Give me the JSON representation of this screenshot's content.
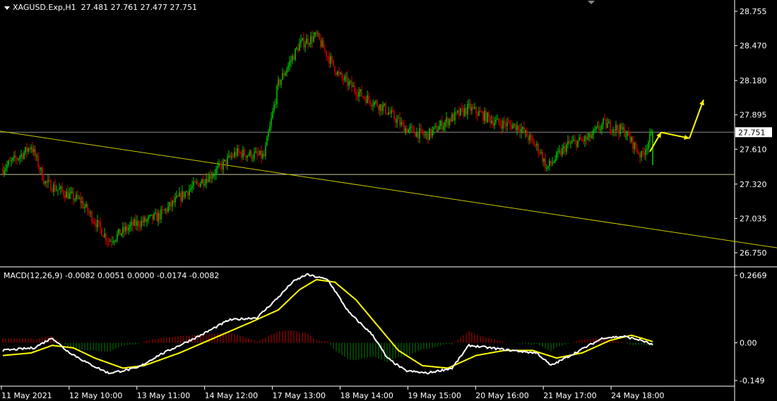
{
  "header": {
    "price_text": "XAGUSD.Exp,H1  27.481 27.761 27.477 27.751",
    "macd_text": "MACD(12,26,9) -0.0082 0.0051 0.0000 -0.0174 -0.0082"
  },
  "colors": {
    "background": "#000000",
    "bull": "#00c000",
    "bear": "#d00000",
    "trendline": "#c8c800",
    "arrow": "#ffff00",
    "macd_line": "#ffffff",
    "signal_line": "#ffff00",
    "grid": "#ffffff"
  },
  "chart_data": [
    {
      "type": "candlestick",
      "symbol": "XAGUSD.Exp",
      "timeframe": "H1",
      "ylim": [
        26.68,
        28.85
      ],
      "y_ticks": [
        "28.755",
        "28.470",
        "28.180",
        "27.895",
        "27.610",
        "27.320",
        "27.035",
        "26.750"
      ],
      "x_ticks": [
        "11 May 2021",
        "12 May 10:00",
        "13 May 11:00",
        "14 May 12:00",
        "17 May 13:00",
        "18 May 14:00",
        "19 May 15:00",
        "20 May 16:00",
        "21 May 17:00",
        "24 May 18:00"
      ],
      "ohlc_last": {
        "open": 27.481,
        "high": 27.761,
        "low": 27.477,
        "close": 27.751
      },
      "current_price_label": "27.751",
      "anchor_closes": [
        [
          0,
          27.45
        ],
        [
          15,
          27.58
        ],
        [
          20,
          27.64
        ],
        [
          30,
          27.33
        ],
        [
          55,
          27.18
        ],
        [
          75,
          26.85
        ],
        [
          92,
          26.98
        ],
        [
          110,
          27.05
        ],
        [
          130,
          27.26
        ],
        [
          150,
          27.42
        ],
        [
          165,
          27.58
        ],
        [
          185,
          27.55
        ],
        [
          195,
          28.15
        ],
        [
          210,
          28.48
        ],
        [
          222,
          28.55
        ],
        [
          238,
          28.22
        ],
        [
          255,
          28.05
        ],
        [
          270,
          27.95
        ],
        [
          285,
          27.78
        ],
        [
          300,
          27.72
        ],
        [
          315,
          27.85
        ],
        [
          330,
          27.95
        ],
        [
          350,
          27.83
        ],
        [
          365,
          27.8
        ],
        [
          380,
          27.6
        ],
        [
          385,
          27.45
        ],
        [
          400,
          27.65
        ],
        [
          415,
          27.7
        ],
        [
          425,
          27.82
        ],
        [
          440,
          27.76
        ],
        [
          452,
          27.55
        ],
        [
          460,
          27.751
        ]
      ],
      "horizontal_lines": [
        27.751,
        27.4
      ],
      "trendline": {
        "from": [
          0,
          27.76
        ],
        "to": [
          560,
          26.77
        ]
      },
      "annotation_arrows": [
        [
          [
            458,
            27.59
          ],
          [
            466,
            27.75
          ]
        ],
        [
          [
            466,
            27.75
          ],
          [
            486,
            27.7
          ]
        ],
        [
          [
            486,
            27.7
          ],
          [
            496,
            28.02
          ]
        ]
      ]
    },
    {
      "type": "macd",
      "params": "MACD(12,26,9)",
      "values": {
        "a": -0.0082,
        "b": 0.0051,
        "c": 0.0,
        "d": -0.0174,
        "e": -0.0082
      },
      "ylim": [
        -0.149,
        0.2669
      ],
      "y_ticks": [
        "0.2669",
        "0.00",
        "-0.149"
      ],
      "macd_anchors": [
        [
          0,
          -0.03
        ],
        [
          22,
          -0.02
        ],
        [
          35,
          0.02
        ],
        [
          45,
          -0.03
        ],
        [
          60,
          -0.08
        ],
        [
          75,
          -0.12
        ],
        [
          95,
          -0.1
        ],
        [
          110,
          -0.05
        ],
        [
          140,
          0.03
        ],
        [
          160,
          0.09
        ],
        [
          180,
          0.1
        ],
        [
          195,
          0.18
        ],
        [
          205,
          0.24
        ],
        [
          215,
          0.27
        ],
        [
          230,
          0.25
        ],
        [
          245,
          0.12
        ],
        [
          262,
          0.03
        ],
        [
          272,
          -0.06
        ],
        [
          285,
          -0.11
        ],
        [
          300,
          -0.12
        ],
        [
          318,
          -0.1
        ],
        [
          330,
          -0.01
        ],
        [
          345,
          -0.02
        ],
        [
          360,
          -0.03
        ],
        [
          378,
          -0.04
        ],
        [
          388,
          -0.09
        ],
        [
          405,
          -0.04
        ],
        [
          425,
          0.02
        ],
        [
          440,
          0.025
        ],
        [
          452,
          0.01
        ],
        [
          460,
          -0.0082
        ]
      ],
      "signal_anchors": [
        [
          0,
          -0.05
        ],
        [
          20,
          -0.04
        ],
        [
          35,
          -0.01
        ],
        [
          50,
          -0.02
        ],
        [
          65,
          -0.06
        ],
        [
          85,
          -0.1
        ],
        [
          100,
          -0.09
        ],
        [
          125,
          -0.04
        ],
        [
          150,
          0.02
        ],
        [
          175,
          0.08
        ],
        [
          195,
          0.13
        ],
        [
          210,
          0.21
        ],
        [
          222,
          0.25
        ],
        [
          235,
          0.24
        ],
        [
          250,
          0.17
        ],
        [
          265,
          0.07
        ],
        [
          280,
          -0.03
        ],
        [
          297,
          -0.09
        ],
        [
          315,
          -0.1
        ],
        [
          335,
          -0.05
        ],
        [
          355,
          -0.03
        ],
        [
          375,
          -0.03
        ],
        [
          392,
          -0.06
        ],
        [
          410,
          -0.04
        ],
        [
          430,
          0.01
        ],
        [
          445,
          0.03
        ],
        [
          460,
          0.0051
        ]
      ]
    }
  ]
}
